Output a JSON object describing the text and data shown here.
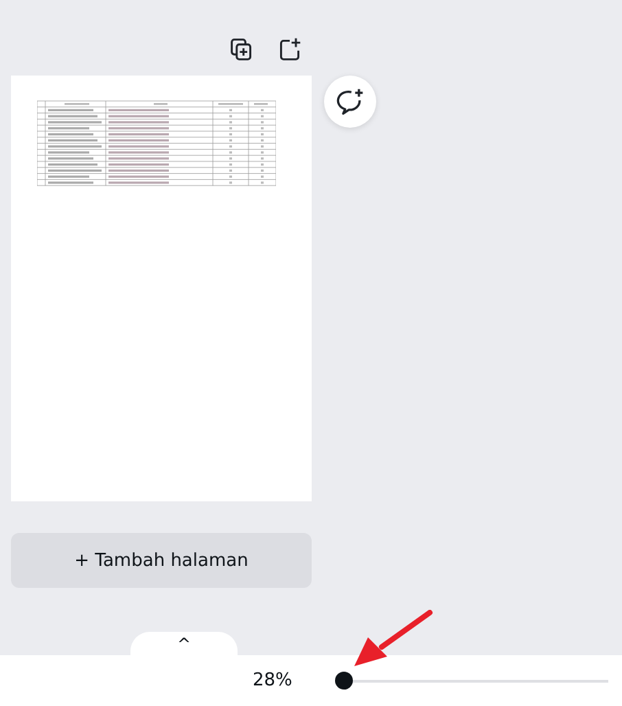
{
  "add_page_button": {
    "label": "+ Tambah halaman"
  },
  "pages_toggle": {
    "label": "^"
  },
  "zoom": {
    "reading": "28%",
    "level": 0
  }
}
